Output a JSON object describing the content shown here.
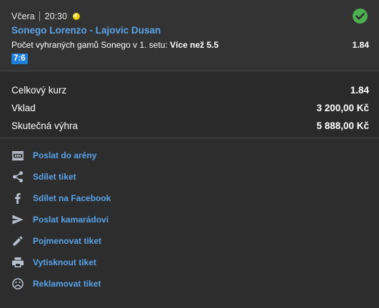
{
  "ticket": {
    "day": "Včera",
    "time": "20:30",
    "sport_icon": "tennis-ball-icon",
    "status_icon": "check-circle-icon",
    "match": "Sonego Lorenzo - Lajovic Dusan",
    "market_prefix": "Počet vyhraných gamů Sonego v 1. setu:",
    "market_selection": "Více než 5.5",
    "odd": "1.84",
    "score": "7:6"
  },
  "summary": {
    "total_odds_label": "Celkový kurz",
    "total_odds_value": "1.84",
    "stake_label": "Vklad",
    "stake_value": "3 200,00 Kč",
    "win_label": "Skutečná výhra",
    "win_value": "5 888,00 Kč"
  },
  "actions": [
    {
      "icon": "arena-icon",
      "label": "Poslat do arény"
    },
    {
      "icon": "share-icon",
      "label": "Sdílet tiket"
    },
    {
      "icon": "facebook-icon",
      "label": "Sdílet na Facebook"
    },
    {
      "icon": "send-icon",
      "label": "Poslat kamarádovi"
    },
    {
      "icon": "pencil-icon",
      "label": "Pojmenovat tiket"
    },
    {
      "icon": "printer-icon",
      "label": "Vytisknout tiket"
    },
    {
      "icon": "sad-face-icon",
      "label": "Reklamovat tiket"
    }
  ],
  "colors": {
    "link": "#5ba3e8",
    "success": "#4caf50",
    "score_badge": "#1d7fd8",
    "background": "#2d2d2d"
  }
}
